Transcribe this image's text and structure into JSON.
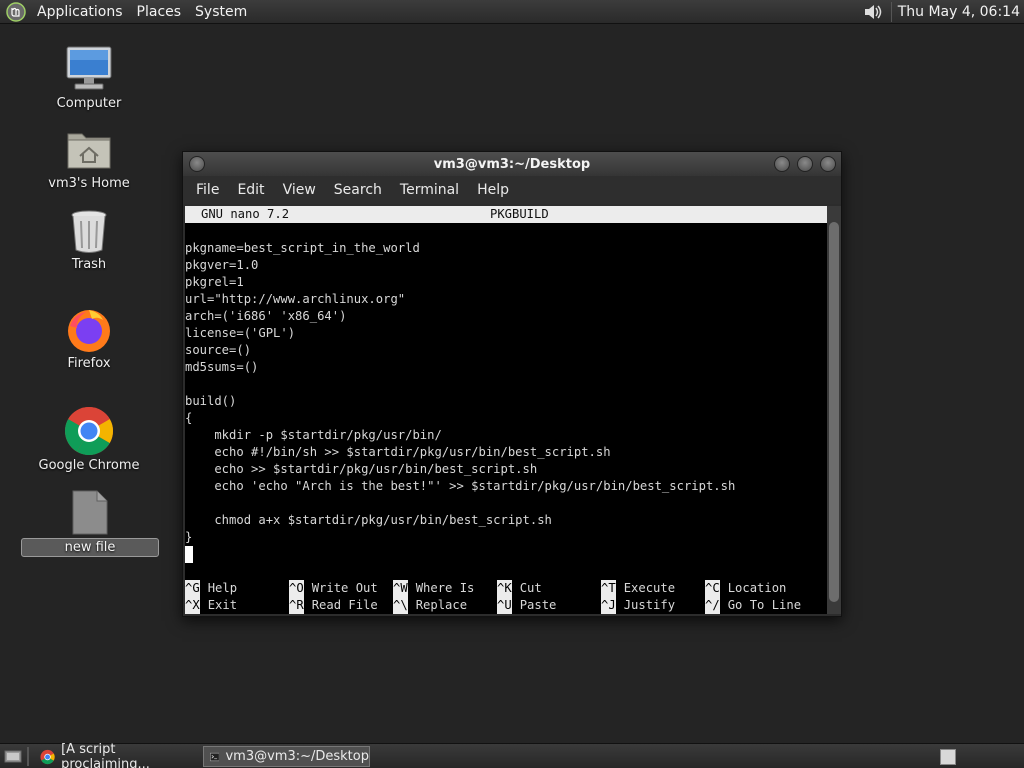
{
  "top_panel": {
    "menus": [
      "Applications",
      "Places",
      "System"
    ],
    "clock": "Thu May  4, 06:14"
  },
  "desktop_icons": [
    {
      "label": "Computer",
      "icon": "computer-icon"
    },
    {
      "label": "vm3's Home",
      "icon": "home-folder-icon"
    },
    {
      "label": "Trash",
      "icon": "trash-icon"
    },
    {
      "label": "Firefox",
      "icon": "firefox-icon"
    },
    {
      "label": "Google Chrome",
      "icon": "chrome-icon"
    },
    {
      "label": "new file",
      "icon": "file-icon",
      "selected": true
    }
  ],
  "window": {
    "title": "vm3@vm3:~/Desktop",
    "menus": [
      "File",
      "Edit",
      "View",
      "Search",
      "Terminal",
      "Help"
    ]
  },
  "nano": {
    "version": "GNU nano 7.2",
    "filename": "PKGBUILD",
    "lines": [
      "pkgname=best_script_in_the_world",
      "pkgver=1.0",
      "pkgrel=1",
      "url=\"http://www.archlinux.org\"",
      "arch=('i686' 'x86_64')",
      "license=('GPL')",
      "source=()",
      "md5sums=()",
      "",
      "build()",
      "{",
      "    mkdir -p $startdir/pkg/usr/bin/",
      "    echo #!/bin/sh >> $startdir/pkg/usr/bin/best_script.sh",
      "    echo >> $startdir/pkg/usr/bin/best_script.sh",
      "    echo 'echo \"Arch is the best!\"' >> $startdir/pkg/usr/bin/best_script.sh",
      "",
      "    chmod a+x $startdir/pkg/usr/bin/best_script.sh",
      "}"
    ],
    "shortcuts": [
      [
        {
          "key": "^G",
          "label": "Help"
        },
        {
          "key": "^O",
          "label": "Write Out"
        },
        {
          "key": "^W",
          "label": "Where Is"
        },
        {
          "key": "^K",
          "label": "Cut"
        },
        {
          "key": "^T",
          "label": "Execute"
        },
        {
          "key": "^C",
          "label": "Location"
        }
      ],
      [
        {
          "key": "^X",
          "label": "Exit"
        },
        {
          "key": "^R",
          "label": "Read File"
        },
        {
          "key": "^\\",
          "label": "Replace"
        },
        {
          "key": "^U",
          "label": "Paste"
        },
        {
          "key": "^J",
          "label": "Justify"
        },
        {
          "key": "^/",
          "label": "Go To Line"
        }
      ]
    ]
  },
  "taskbar": {
    "tasks": [
      {
        "label": "[A script proclaiming...",
        "icon": "chrome-icon",
        "active": false
      },
      {
        "label": "vm3@vm3:~/Desktop",
        "icon": "terminal-icon",
        "active": true
      }
    ]
  }
}
